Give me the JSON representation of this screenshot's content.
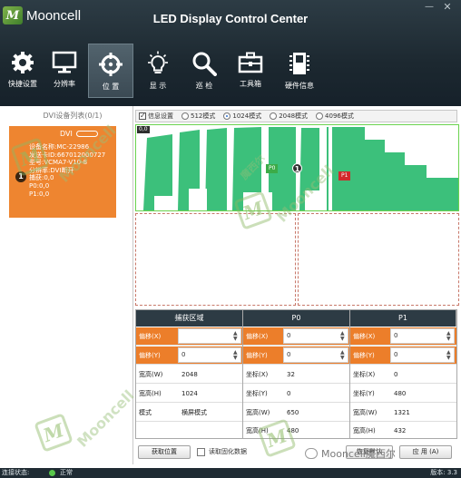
{
  "app": {
    "logo_text": "Mooncell",
    "logo_glyph": "M",
    "title": "LED Display Control Center",
    "minimize_label": "—",
    "close_label": "✕"
  },
  "toolbar": {
    "items": [
      {
        "label": "快捷设置",
        "icon": "gear-icon"
      },
      {
        "label": "分辨率",
        "icon": "monitor-icon"
      },
      {
        "label": "位 置",
        "icon": "crosshair-icon"
      },
      {
        "label": "显 示",
        "icon": "bulb-icon"
      },
      {
        "label": "巡 检",
        "icon": "magnifier-icon"
      },
      {
        "label": "工具箱",
        "icon": "toolbox-icon"
      },
      {
        "label": "硬件信息",
        "icon": "chip-icon"
      }
    ],
    "active_index": 2
  },
  "left": {
    "title": "DVI设备列表(0/1)",
    "card": {
      "dvi": "DVI",
      "number": "1",
      "lines": [
        "设备名称:MC-22986",
        "发送卡ID:667012000727",
        "型号:VCMA7-V10-8",
        "分辨率:DVI断开",
        "捕获:0,0",
        "P0:0,0",
        "P1:0,0"
      ]
    }
  },
  "modes": {
    "info_label": "信息设置",
    "info_checked": true,
    "options": [
      "512模式",
      "1024模式",
      "2048模式",
      "4096模式"
    ],
    "selected": "1024模式"
  },
  "canvas": {
    "zone_tag": "0,0",
    "p0": "P0",
    "p1": "P1",
    "marker": "1",
    "accent": "#3cc07b",
    "p0_color": "#3cab48",
    "p1_color": "#d2282b"
  },
  "table": {
    "headers": [
      "捕获区域",
      "P0",
      "P1"
    ],
    "capture": {
      "offset_x_label": "偏移(X)",
      "offset_x_value": "",
      "offset_y_label": "偏移(Y)",
      "offset_y_value": "0",
      "width_label": "宽高(W)",
      "width_value": "2048",
      "height_label": "宽高(H)",
      "height_value": "1024",
      "mode_label": "模式",
      "mode_value": "横屏模式"
    },
    "p0": {
      "offset_x_label": "偏移(X)",
      "offset_x_value": "0",
      "offset_y_label": "偏移(Y)",
      "offset_y_value": "0",
      "coord_x_label": "坐标(X)",
      "coord_x_value": "32",
      "coord_y_label": "坐标(Y)",
      "coord_y_value": "0",
      "width_label": "宽高(W)",
      "width_value": "650",
      "height_label": "宽高(H)",
      "height_value": "480"
    },
    "p1": {
      "offset_x_label": "偏移(X)",
      "offset_x_value": "0",
      "offset_y_label": "偏移(Y)",
      "offset_y_value": "0",
      "coord_x_label": "坐标(X)",
      "coord_x_value": "0",
      "coord_y_label": "坐标(Y)",
      "coord_y_value": "480",
      "width_label": "宽高(W)",
      "width_value": "1321",
      "height_label": "宽高(H)",
      "height_value": "432"
    }
  },
  "bottom": {
    "get_position": "获取位置",
    "read_label": "读取固化数据",
    "restore": "恢复默认",
    "apply": "应 用 (A)"
  },
  "status": {
    "connection_label": "连接状态:",
    "state": "正常",
    "version_label": "版本: 3.3"
  },
  "watermark": {
    "text": "Mooncell",
    "cn_text": "魔西尔",
    "footer": "Mooncell魔西尔"
  }
}
